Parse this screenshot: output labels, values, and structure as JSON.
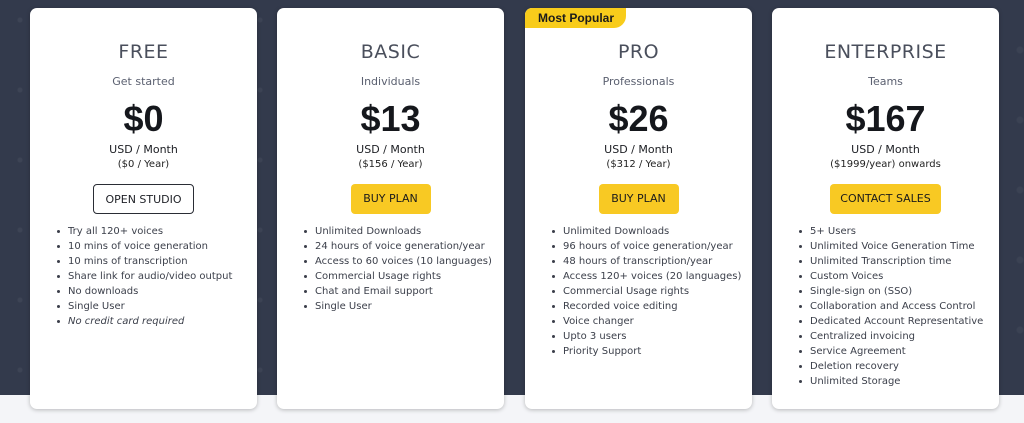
{
  "plans": [
    {
      "name": "FREE",
      "subtitle": "Get started",
      "price": "$0",
      "unit": "USD / Month",
      "yearly": "($0 / Year)",
      "button": "OPEN STUDIO",
      "features": [
        "Try all 120+ voices",
        "10 mins of voice generation",
        "10 mins of transcription",
        "Share link for audio/video output",
        "No downloads",
        "Single User",
        "No credit card required"
      ]
    },
    {
      "name": "BASIC",
      "subtitle": "Individuals",
      "price": "$13",
      "unit": "USD / Month",
      "yearly": "($156 / Year)",
      "button": "BUY PLAN",
      "features": [
        "Unlimited Downloads",
        "24 hours of voice generation/year",
        "Access to 60 voices (10 languages)",
        "Commercial Usage rights",
        "Chat and Email support",
        "Single User"
      ]
    },
    {
      "name": "PRO",
      "badge": "Most Popular",
      "subtitle": "Professionals",
      "price": "$26",
      "unit": "USD / Month",
      "yearly": "($312 / Year)",
      "button": "BUY PLAN",
      "features": [
        "Unlimited Downloads",
        "96 hours of voice generation/year",
        "48 hours of transcription/year",
        "Access 120+ voices (20 languages)",
        "Commercial Usage rights",
        "Recorded voice editing",
        "Voice changer",
        "Upto 3 users",
        "Priority Support"
      ]
    },
    {
      "name": "ENTERPRISE",
      "subtitle": "Teams",
      "price": "$167",
      "unit": "USD / Month",
      "yearly": "($1999/year) onwards",
      "button": "CONTACT SALES",
      "features": [
        "5+ Users",
        "Unlimited Voice Generation Time",
        "Unlimited Transcription time",
        "Custom Voices",
        "Single-sign on (SSO)",
        "Collaboration and Access Control",
        "Dedicated Account Representative",
        "Centralized invoicing",
        "Service Agreement",
        "Deletion recovery",
        "Unlimited Storage"
      ]
    }
  ],
  "colors": {
    "background": "#333a4c",
    "accent_yellow": "#f8c923"
  }
}
